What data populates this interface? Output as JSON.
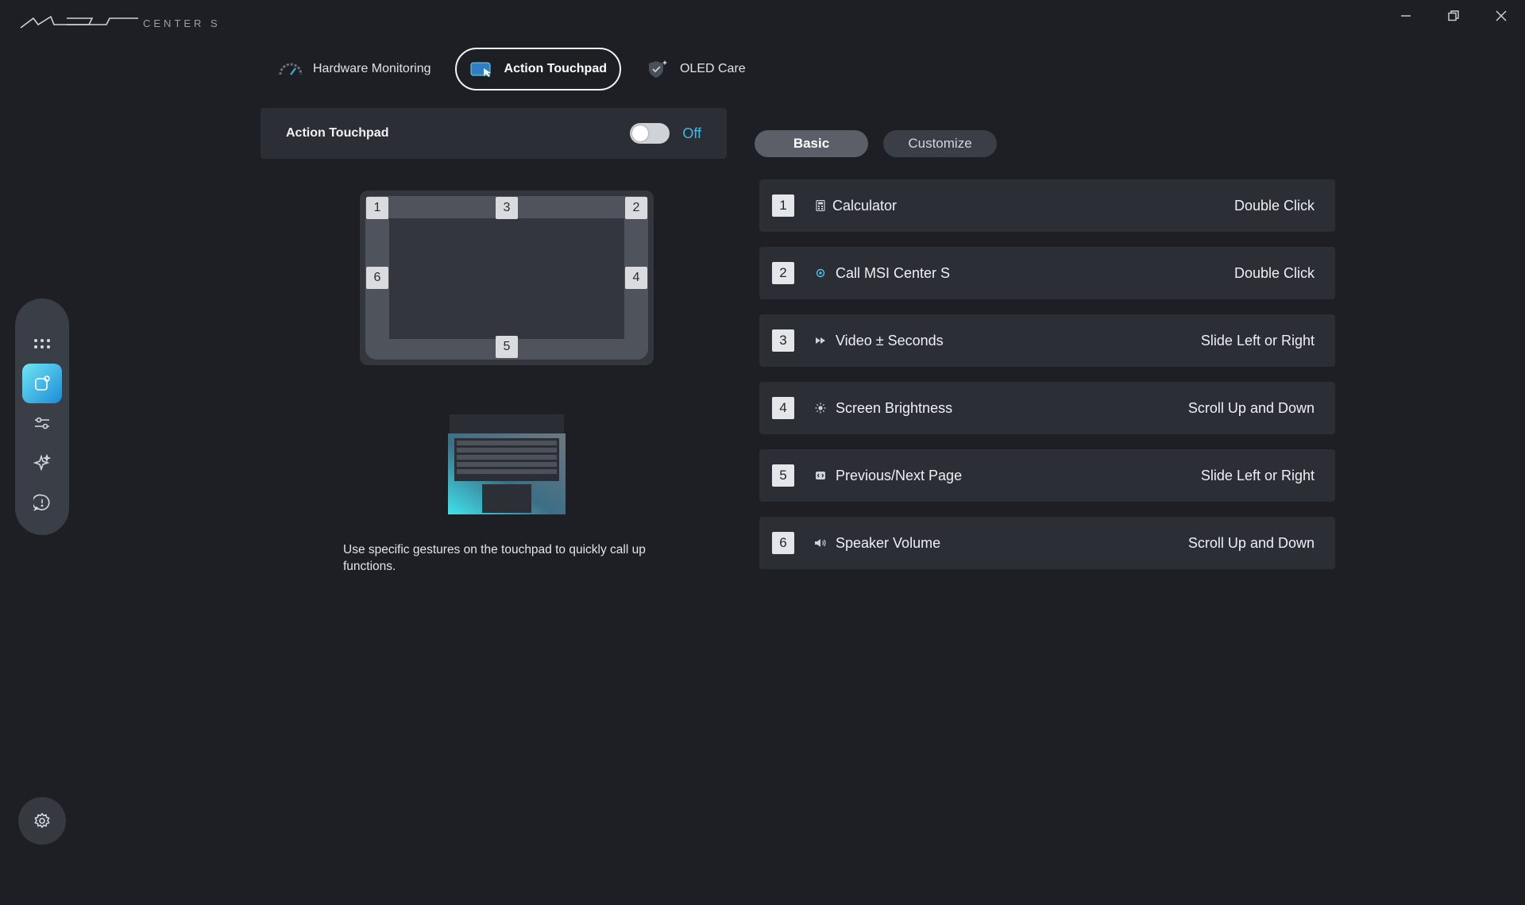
{
  "app": {
    "logo_text": "MSI CENTER S"
  },
  "window": {
    "minimize_icon": "minimize-icon",
    "restore_icon": "restore-icon",
    "close_icon": "close-icon"
  },
  "tabs": [
    {
      "label": "Hardware Monitoring",
      "icon": "gauge-icon",
      "active": false
    },
    {
      "label": "Action Touchpad",
      "icon": "touchpad-icon",
      "active": true
    },
    {
      "label": "OLED Care",
      "icon": "shield-icon",
      "active": false
    }
  ],
  "toggle": {
    "label": "Action Touchpad",
    "state": "Off",
    "on": false
  },
  "touchpad": {
    "zones": [
      "1",
      "3",
      "2",
      "6",
      "4",
      "5"
    ]
  },
  "hint": "Use specific gestures on the touchpad to quickly call up functions.",
  "modes": [
    {
      "label": "Basic",
      "active": true
    },
    {
      "label": "Customize",
      "active": false
    }
  ],
  "gestures": [
    {
      "num": "1",
      "icon": "calculator-icon",
      "name": "Calculator",
      "gesture": "Double Click"
    },
    {
      "num": "2",
      "icon": "msi-center-icon",
      "name": "Call MSI Center S",
      "gesture": "Double Click"
    },
    {
      "num": "3",
      "icon": "fast-forward-icon",
      "name": "Video ± Seconds",
      "gesture": "Slide Left or Right"
    },
    {
      "num": "4",
      "icon": "brightness-icon",
      "name": "Screen Brightness",
      "gesture": "Scroll Up and Down"
    },
    {
      "num": "5",
      "icon": "page-icon",
      "name": "Previous/Next Page",
      "gesture": "Slide Left or Right"
    },
    {
      "num": "6",
      "icon": "speaker-icon",
      "name": "Speaker Volume",
      "gesture": "Scroll Up and Down"
    }
  ],
  "sidebar": {
    "items": [
      {
        "icon": "apps-grid-icon",
        "active": false
      },
      {
        "icon": "device-feature-icon",
        "active": true
      },
      {
        "icon": "sliders-icon",
        "active": false
      },
      {
        "icon": "sparkle-icon",
        "active": false
      },
      {
        "icon": "support-icon",
        "active": false
      }
    ],
    "settings_icon": "gear-icon"
  },
  "colors": {
    "background": "#1d1f24",
    "panel": "#2b2e35",
    "accent": "#3fb8e8",
    "active_gradient_start": "#6fe6f2",
    "active_gradient_end": "#1d8bd8"
  }
}
